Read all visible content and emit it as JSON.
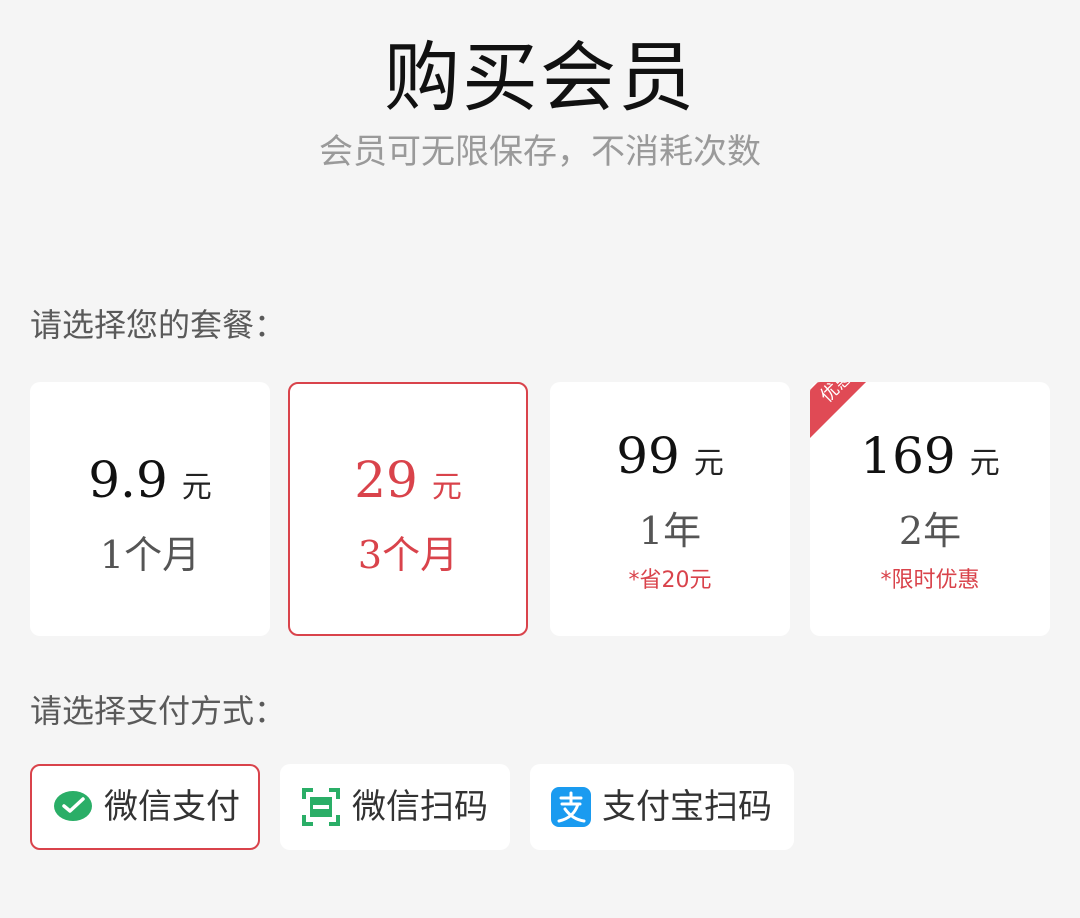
{
  "header": {
    "title": "购买会员",
    "subtitle": "会员可无限保存，不消耗次数"
  },
  "plans_section": {
    "label": "请选择您的套餐："
  },
  "plans": [
    {
      "price": "9.9",
      "unit": "元",
      "duration": "1个月",
      "note": "",
      "selected": false,
      "badge": ""
    },
    {
      "price": "29",
      "unit": "元",
      "duration": "3个月",
      "note": "",
      "selected": true,
      "badge": ""
    },
    {
      "price": "99",
      "unit": "元",
      "duration": "1年",
      "note": "*省20元",
      "selected": false,
      "badge": ""
    },
    {
      "price": "169",
      "unit": "元",
      "duration": "2年",
      "note": "*限时优惠",
      "selected": false,
      "badge": "优惠"
    }
  ],
  "payment_section": {
    "label": "请选择支付方式："
  },
  "payment_methods": [
    {
      "label": "微信支付",
      "icon": "wechat-pay-icon",
      "selected": true
    },
    {
      "label": "微信扫码",
      "icon": "wechat-scan-icon",
      "selected": false
    },
    {
      "label": "支付宝扫码",
      "icon": "alipay-icon",
      "selected": false
    }
  ],
  "colors": {
    "accent": "#d9434b",
    "background": "#f5f5f5",
    "card": "#ffffff",
    "wechat_green": "#2aae67",
    "alipay_blue": "#1a9bf0"
  }
}
